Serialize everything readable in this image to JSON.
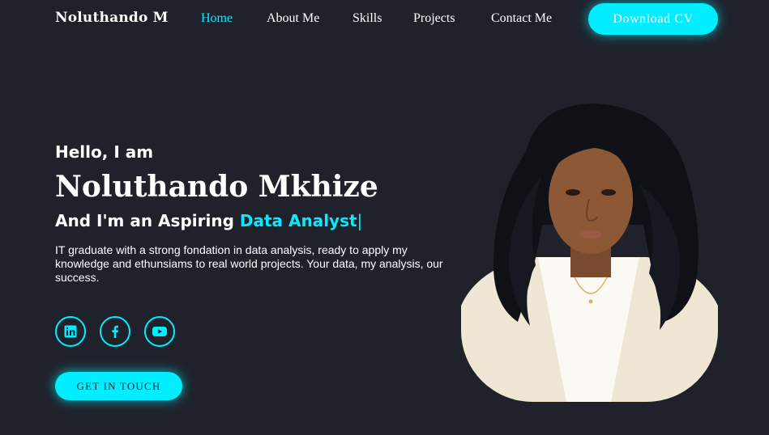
{
  "header": {
    "brand": "Noluthando M",
    "nav": [
      "Home",
      "About Me",
      "Skills",
      "Projects",
      "Contact Me"
    ],
    "active_nav": "Home",
    "cta_label": "Download CV"
  },
  "hero": {
    "greeting": "Hello, I am",
    "name": "Noluthando Mkhize",
    "role_prefix": "And I'm an Aspiring ",
    "role_highlight": "Data Analyst",
    "role_caret": "|",
    "bio": "IT graduate with a strong fondation in data analysis, ready to apply my knowledge and ethunsiams to real world projects. Your data, my analysis, our success.",
    "socials": [
      "linkedin-icon",
      "facebook-icon",
      "youtube-icon"
    ],
    "cta_label": "GET IN TOUCH",
    "portrait": "profile-photo"
  },
  "colors": {
    "background": "#1f222b",
    "accent": "#00eeff",
    "text": "#ffffff"
  }
}
